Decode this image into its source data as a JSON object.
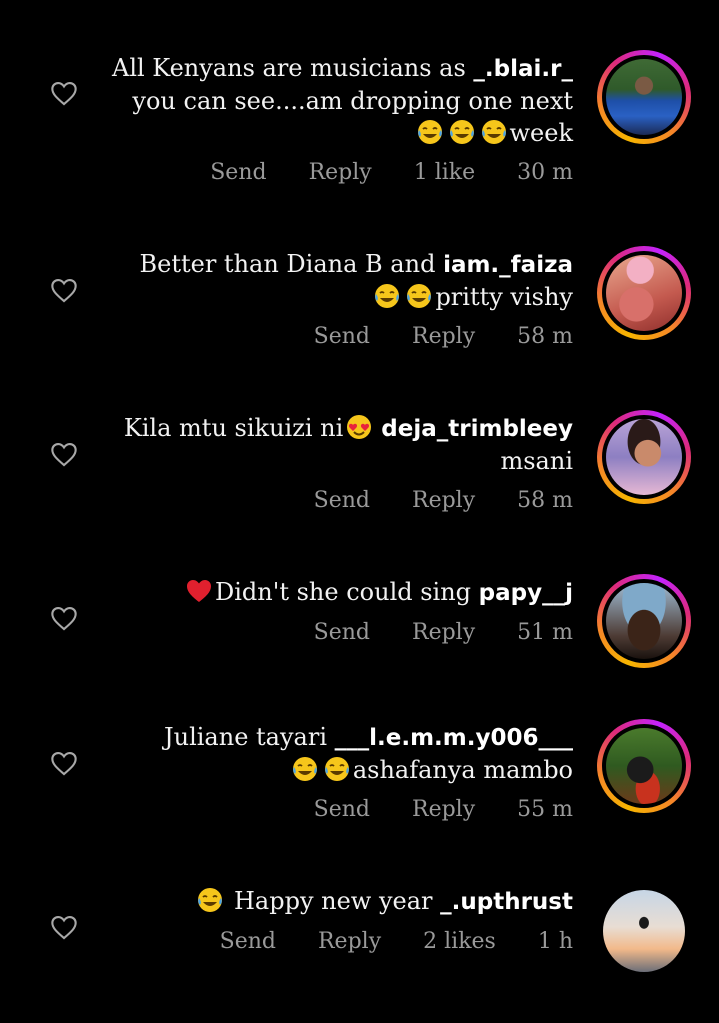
{
  "comments": [
    {
      "username": "_.blai.r_",
      "text_before": "All Kenyans are musicians as ",
      "text_after": " you can see....am dropping one next ",
      "emoji_icons": [
        "laughing-crying-emoji",
        "laughing-crying-emoji",
        "laughing-crying-emoji"
      ],
      "text_end": "week",
      "send": "Send",
      "reply": "Reply",
      "likes": "1 like",
      "time": "30 m",
      "story_ring": true
    },
    {
      "username": "iam._faiza",
      "text_before": "Better than Diana B and ",
      "text_after": " ",
      "emoji_icons": [
        "laughing-crying-emoji",
        "laughing-crying-emoji"
      ],
      "text_end": "pritty vishy",
      "send": "Send",
      "reply": "Reply",
      "likes": "",
      "time": "58 m",
      "story_ring": true
    },
    {
      "username": "deja_trimbleey",
      "text_before": "Kila mtu sikuizi ni",
      "emoji_icons_inline": [
        "heart-eyes-emoji"
      ],
      "text_after": " msani",
      "send": "Send",
      "reply": "Reply",
      "likes": "",
      "time": "58 m",
      "story_ring": true
    },
    {
      "username": "papy__j",
      "text_before": "Didn't she could sing ",
      "emoji_icons_lead": [
        "red-heart-emoji"
      ],
      "send": "Send",
      "reply": "Reply",
      "likes": "",
      "time": "51 m",
      "story_ring": true
    },
    {
      "username": "___l.e.m.m.y006___",
      "text_before": "Juliane tayari ",
      "emoji_icons": [
        "laughing-crying-emoji",
        "laughing-crying-emoji"
      ],
      "text_end": "ashafanya mambo",
      "send": "Send",
      "reply": "Reply",
      "likes": "",
      "time": "55 m",
      "story_ring": true
    },
    {
      "username": "_.upthrust",
      "text_before": " Happy new year ",
      "emoji_icons_lead": [
        "laughing-crying-emoji"
      ],
      "send": "Send",
      "reply": "Reply",
      "likes": "2 likes",
      "time": "1 h",
      "story_ring": false
    }
  ]
}
